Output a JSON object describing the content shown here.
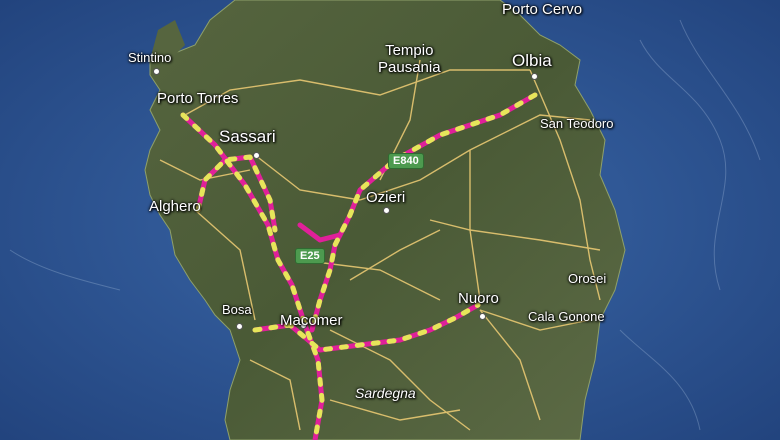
{
  "map": {
    "cities": {
      "stintino": "Stintino",
      "porto_cervo": "Porto Cervo",
      "porto_torres": "Porto Torres",
      "tempio_line1": "Tempio",
      "tempio_line2": "Pausania",
      "olbia": "Olbia",
      "sassari": "Sassari",
      "san_teodoro": "San Teodoro",
      "ozieri": "Ozieri",
      "alghero": "Alghero",
      "orosei": "Orosei",
      "nuoro": "Nuoro",
      "bosa": "Bosa",
      "macomer": "Macomer",
      "cala_gonone": "Cala Gonone",
      "sardegna": "Sardegna"
    },
    "road_shields": {
      "e840": "E840",
      "e25": "E25"
    },
    "colors": {
      "sea": "#2a4f8f",
      "land": "#4f5f3a",
      "route": "#e0209a",
      "route_dash": "#e6e65a",
      "road": "#e8c872"
    }
  }
}
